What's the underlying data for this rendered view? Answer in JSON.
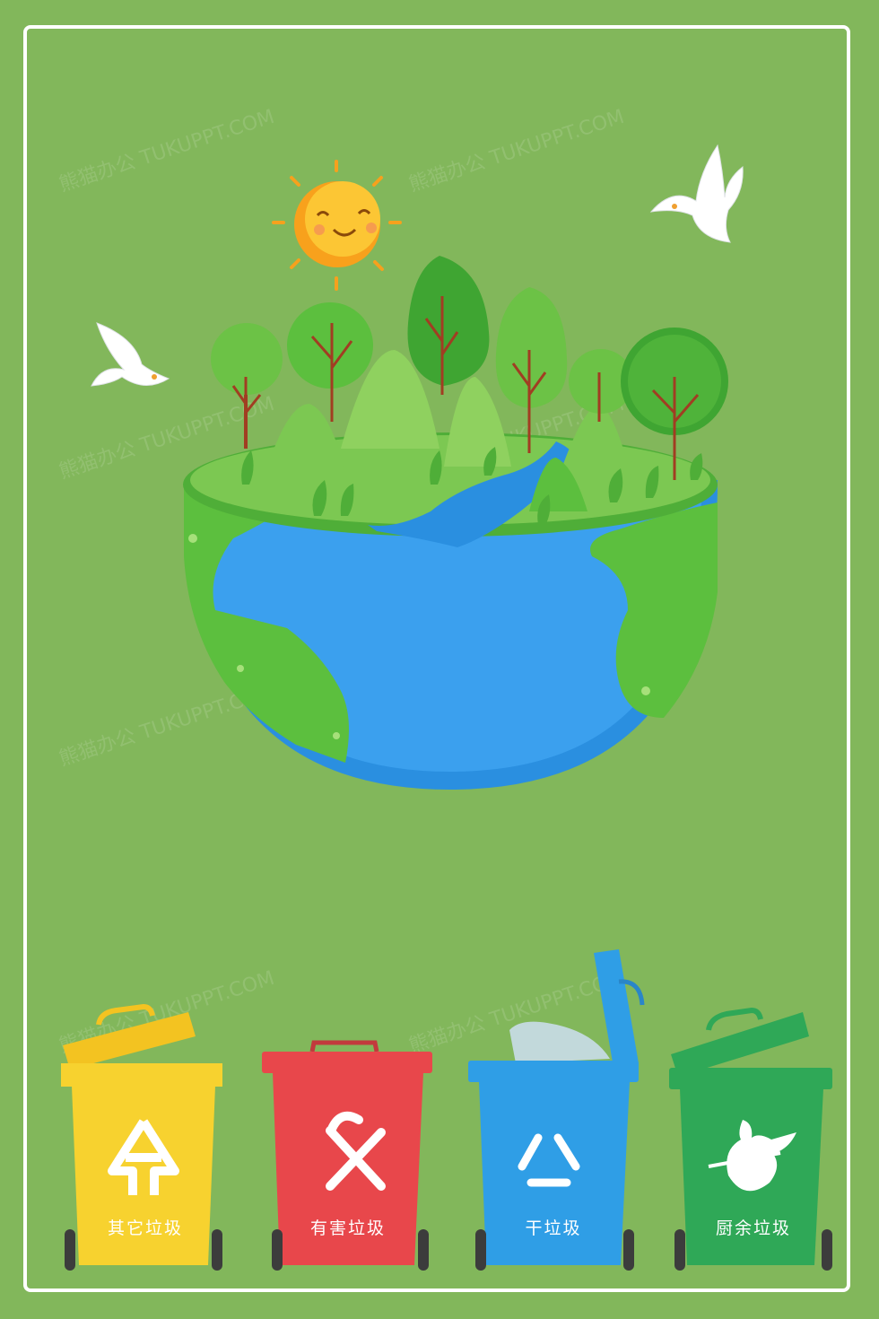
{
  "bins": [
    {
      "label": "其它垃圾",
      "icon": "other-waste-icon",
      "color": "#f7d22f"
    },
    {
      "label": "有害垃圾",
      "icon": "hazardous-waste-icon",
      "color": "#e8474b"
    },
    {
      "label": "干垃圾",
      "icon": "recycle-icon",
      "color": "#2f9ee6"
    },
    {
      "label": "厨余垃圾",
      "icon": "kitchen-waste-icon",
      "color": "#2fa857"
    }
  ],
  "watermark": "熊猫办公 TUKUPPT.COM",
  "colors": {
    "background": "#82b75b",
    "frame": "#ffffff",
    "ocean": "#2a8fe0",
    "land": "#5cbf3e"
  }
}
